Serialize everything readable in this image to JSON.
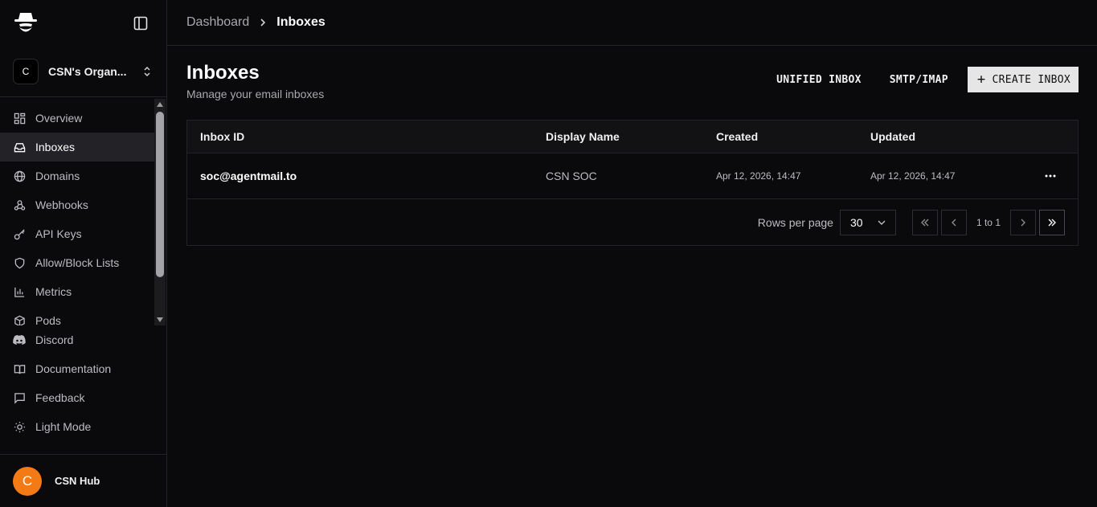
{
  "sidebar": {
    "org": {
      "avatar_letter": "C",
      "name": "CSN's Organ..."
    },
    "nav_items": [
      {
        "label": "Overview",
        "icon": "grid-icon"
      },
      {
        "label": "Inboxes",
        "icon": "inbox-icon",
        "active": true
      },
      {
        "label": "Domains",
        "icon": "globe-icon"
      },
      {
        "label": "Webhooks",
        "icon": "webhook-icon"
      },
      {
        "label": "API Keys",
        "icon": "key-icon"
      },
      {
        "label": "Allow/Block Lists",
        "icon": "shield-icon"
      },
      {
        "label": "Metrics",
        "icon": "bar-chart-icon"
      },
      {
        "label": "Pods",
        "icon": "box-icon"
      }
    ],
    "bottom_items": [
      {
        "label": "Discord",
        "icon": "discord-icon"
      },
      {
        "label": "Documentation",
        "icon": "book-icon"
      },
      {
        "label": "Feedback",
        "icon": "message-icon"
      },
      {
        "label": "Light Mode",
        "icon": "sun-icon"
      }
    ],
    "user": {
      "avatar_letter": "C",
      "name": "CSN Hub",
      "avatar_color": "#f47a16"
    }
  },
  "breadcrumb": {
    "parent": "Dashboard",
    "current": "Inboxes"
  },
  "header": {
    "title": "Inboxes",
    "subtitle": "Manage your email inboxes",
    "unified_label": "UNIFIED INBOX",
    "smtp_label": "SMTP/IMAP",
    "create_label": "CREATE INBOX"
  },
  "table": {
    "columns": [
      "Inbox ID",
      "Display Name",
      "Created",
      "Updated"
    ],
    "rows": [
      {
        "inbox_id": "soc@agentmail.to",
        "display_name": "CSN SOC",
        "created": "Apr 12, 2026, 14:47",
        "updated": "Apr 12, 2026, 14:47"
      }
    ]
  },
  "pagination": {
    "rows_label": "Rows per page",
    "rows_value": "30",
    "info": "1 to 1"
  },
  "colors": {
    "background": "#0a090b",
    "active_nav": "#232226",
    "primary_button": "#e6e6e6"
  }
}
